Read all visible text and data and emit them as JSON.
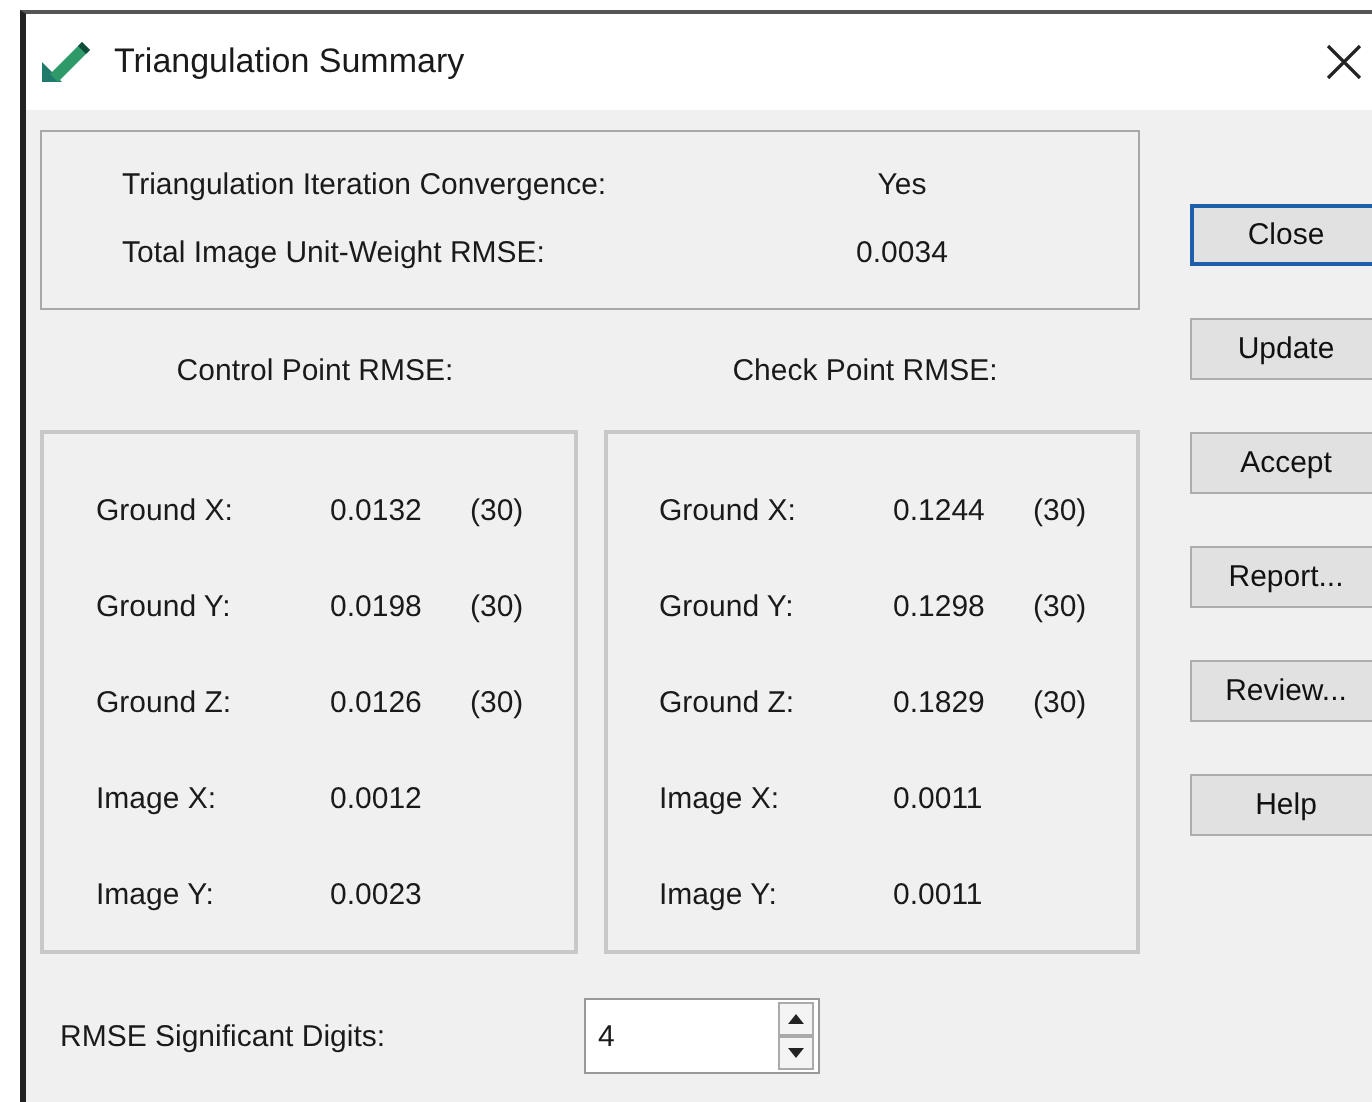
{
  "window": {
    "title": "Triangulation Summary"
  },
  "summary": [
    {
      "label": "Triangulation Iteration Convergence:",
      "value": "Yes"
    },
    {
      "label": "Total Image Unit-Weight RMSE:",
      "value": "0.0034"
    }
  ],
  "panels": [
    {
      "heading": "Control Point RMSE:",
      "rows": [
        {
          "label": "Ground X:",
          "value": "0.0132",
          "count": "(30)"
        },
        {
          "label": "Ground Y:",
          "value": "0.0198",
          "count": "(30)"
        },
        {
          "label": "Ground Z:",
          "value": "0.0126",
          "count": "(30)"
        },
        {
          "label": "Image X:",
          "value": "0.0012"
        },
        {
          "label": "Image Y:",
          "value": "0.0023"
        }
      ]
    },
    {
      "heading": "Check Point RMSE:",
      "rows": [
        {
          "label": "Ground X:",
          "value": "0.1244",
          "count": "(30)"
        },
        {
          "label": "Ground Y:",
          "value": "0.1298",
          "count": "(30)"
        },
        {
          "label": "Ground Z:",
          "value": "0.1829",
          "count": "(30)"
        },
        {
          "label": "Image X:",
          "value": "0.0011"
        },
        {
          "label": "Image Y:",
          "value": "0.0011"
        }
      ]
    }
  ],
  "digits": {
    "label": "RMSE Significant Digits:",
    "value": "4"
  },
  "buttons": [
    {
      "label": "Close",
      "default": true
    },
    {
      "label": "Update",
      "default": false
    },
    {
      "label": "Accept",
      "default": false
    },
    {
      "label": "Report...",
      "default": false
    },
    {
      "label": "Review...",
      "default": false
    },
    {
      "label": "Help",
      "default": false
    }
  ]
}
